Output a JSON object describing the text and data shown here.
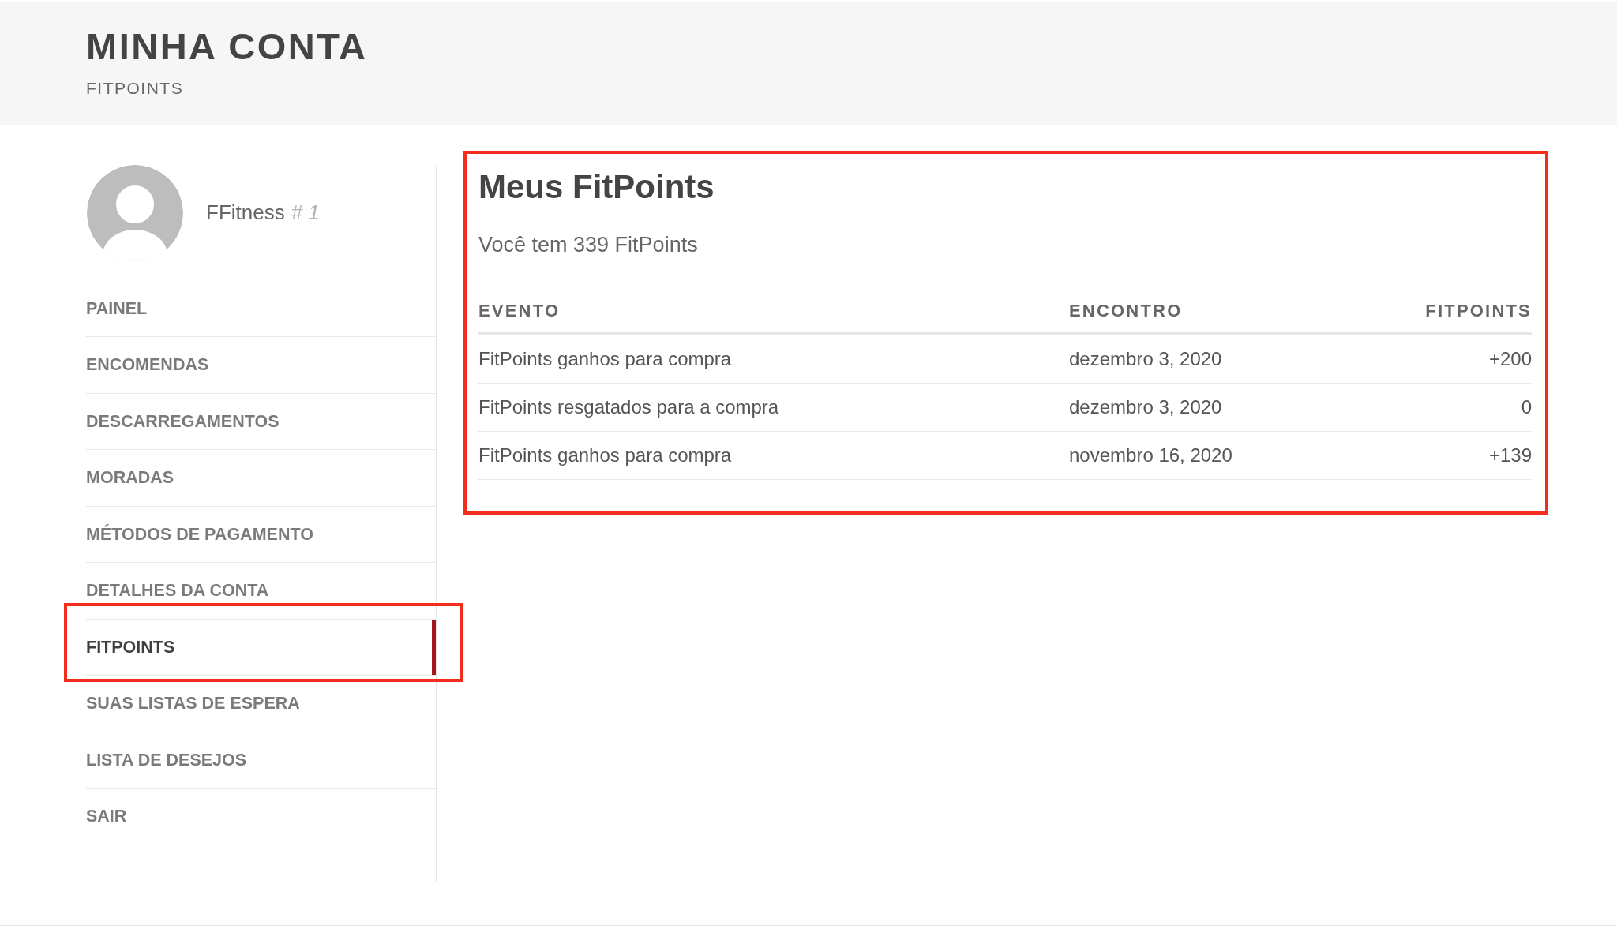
{
  "header": {
    "title": "MINHA CONTA",
    "subtitle": "FITPOINTS"
  },
  "sidebar": {
    "user": {
      "name": "FFitness",
      "number": "# 1"
    },
    "menu": [
      {
        "label": "PAINEL",
        "selected": false,
        "highlighted": false
      },
      {
        "label": "ENCOMENDAS",
        "selected": false,
        "highlighted": false
      },
      {
        "label": "DESCARREGAMENTOS",
        "selected": false,
        "highlighted": false
      },
      {
        "label": "MORADAS",
        "selected": false,
        "highlighted": false
      },
      {
        "label": "MÉTODOS DE PAGAMENTO",
        "selected": false,
        "highlighted": false
      },
      {
        "label": "DETALHES DA CONTA",
        "selected": false,
        "highlighted": false
      },
      {
        "label": "FITPOINTS",
        "selected": true,
        "highlighted": true
      },
      {
        "label": "SUAS LISTAS DE ESPERA",
        "selected": false,
        "highlighted": false
      },
      {
        "label": "LISTA DE DESEJOS",
        "selected": false,
        "highlighted": false
      },
      {
        "label": "SAIR",
        "selected": false,
        "highlighted": false
      }
    ]
  },
  "panel": {
    "highlighted": true,
    "title": "Meus FitPoints",
    "summary": "Você tem 339 FitPoints",
    "table": {
      "columns": [
        "EVENTO",
        "ENCONTRO",
        "FITPOINTS"
      ],
      "rows": [
        [
          "FitPoints ganhos para compra",
          "dezembro 3, 2020",
          "+200"
        ],
        [
          "FitPoints resgatados para a compra",
          "dezembro 3, 2020",
          "0"
        ],
        [
          "FitPoints ganhos para compra",
          "novembro 16, 2020",
          "+139"
        ]
      ]
    }
  }
}
